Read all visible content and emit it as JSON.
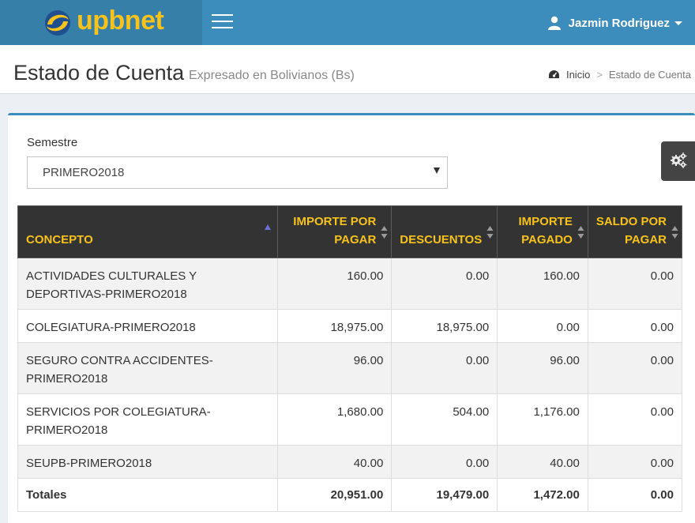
{
  "brand": {
    "logo_text": "upbnet"
  },
  "user": {
    "name": "Jazmin Rodriguez"
  },
  "header": {
    "title": "Estado de Cuenta",
    "subtitle": "Expresado en Bolivianos (Bs)"
  },
  "breadcrumb": {
    "home": "Inicio",
    "separator": ">",
    "current": "Estado de Cuenta"
  },
  "filter": {
    "label": "Semestre",
    "selected": "PRIMERO2018"
  },
  "table": {
    "headers": {
      "concepto": "CONCEPTO",
      "importe": "IMPORTE POR PAGAR",
      "descuentos": "DESCUENTOS",
      "pagado": "IMPORTE PAGADO",
      "saldo": "SALDO POR PAGAR"
    },
    "rows": [
      {
        "concepto": "ACTIVIDADES CULTURALES Y DEPORTIVAS-PRIMERO2018",
        "importe": "160.00",
        "descuentos": "0.00",
        "pagado": "160.00",
        "saldo": "0.00"
      },
      {
        "concepto": "COLEGIATURA-PRIMERO2018",
        "importe": "18,975.00",
        "descuentos": "18,975.00",
        "pagado": "0.00",
        "saldo": "0.00"
      },
      {
        "concepto": "SEGURO CONTRA ACCIDENTES-PRIMERO2018",
        "importe": "96.00",
        "descuentos": "0.00",
        "pagado": "96.00",
        "saldo": "0.00"
      },
      {
        "concepto": "SERVICIOS POR COLEGIATURA-PRIMERO2018",
        "importe": "1,680.00",
        "descuentos": "504.00",
        "pagado": "1,176.00",
        "saldo": "0.00"
      },
      {
        "concepto": "SEUPB-PRIMERO2018",
        "importe": "40.00",
        "descuentos": "0.00",
        "pagado": "40.00",
        "saldo": "0.00"
      }
    ],
    "totals": {
      "label": "Totales",
      "importe": "20,951.00",
      "descuentos": "19,479.00",
      "pagado": "1,472.00",
      "saldo": "0.00"
    }
  },
  "colors": {
    "header_bg": "#3c8dbc",
    "logo_bg": "#367fa9",
    "brand_yellow": "#f7c21b",
    "table_head_bg": "#333333"
  }
}
